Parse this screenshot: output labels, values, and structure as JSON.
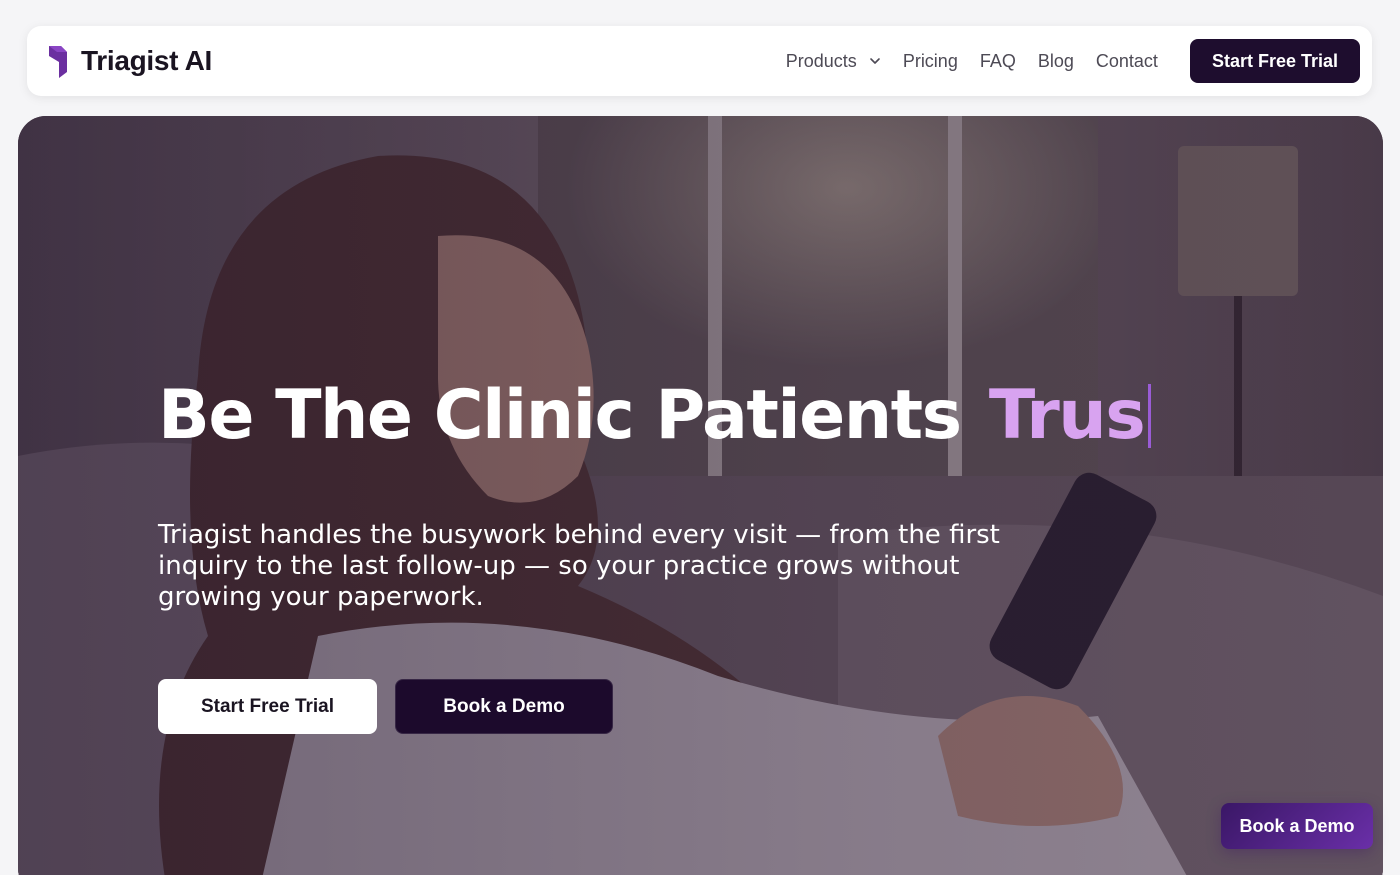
{
  "brand": {
    "name": "Triagist AI",
    "accent_color": "#6b2fa0"
  },
  "nav": {
    "items": [
      {
        "label": "Products",
        "has_dropdown": true
      },
      {
        "label": "Pricing"
      },
      {
        "label": "FAQ"
      },
      {
        "label": "Blog"
      },
      {
        "label": "Contact"
      }
    ],
    "cta_label": "Start Free Trial",
    "cta_color": "#1e0d2e"
  },
  "hero": {
    "title_main": "Be The Clinic Patients",
    "title_typed": "Trus",
    "title_typed_color": "#d8a3f0",
    "subtitle": "Triagist handles the busywork behind every visit — from the first inquiry to the last follow-up — so your practice grows without growing your paperwork.",
    "primary_label": "Start Free Trial",
    "secondary_label": "Book a Demo",
    "background_image": "woman smiling at phone on couch"
  },
  "floating_cta": {
    "label": "Book a Demo"
  }
}
